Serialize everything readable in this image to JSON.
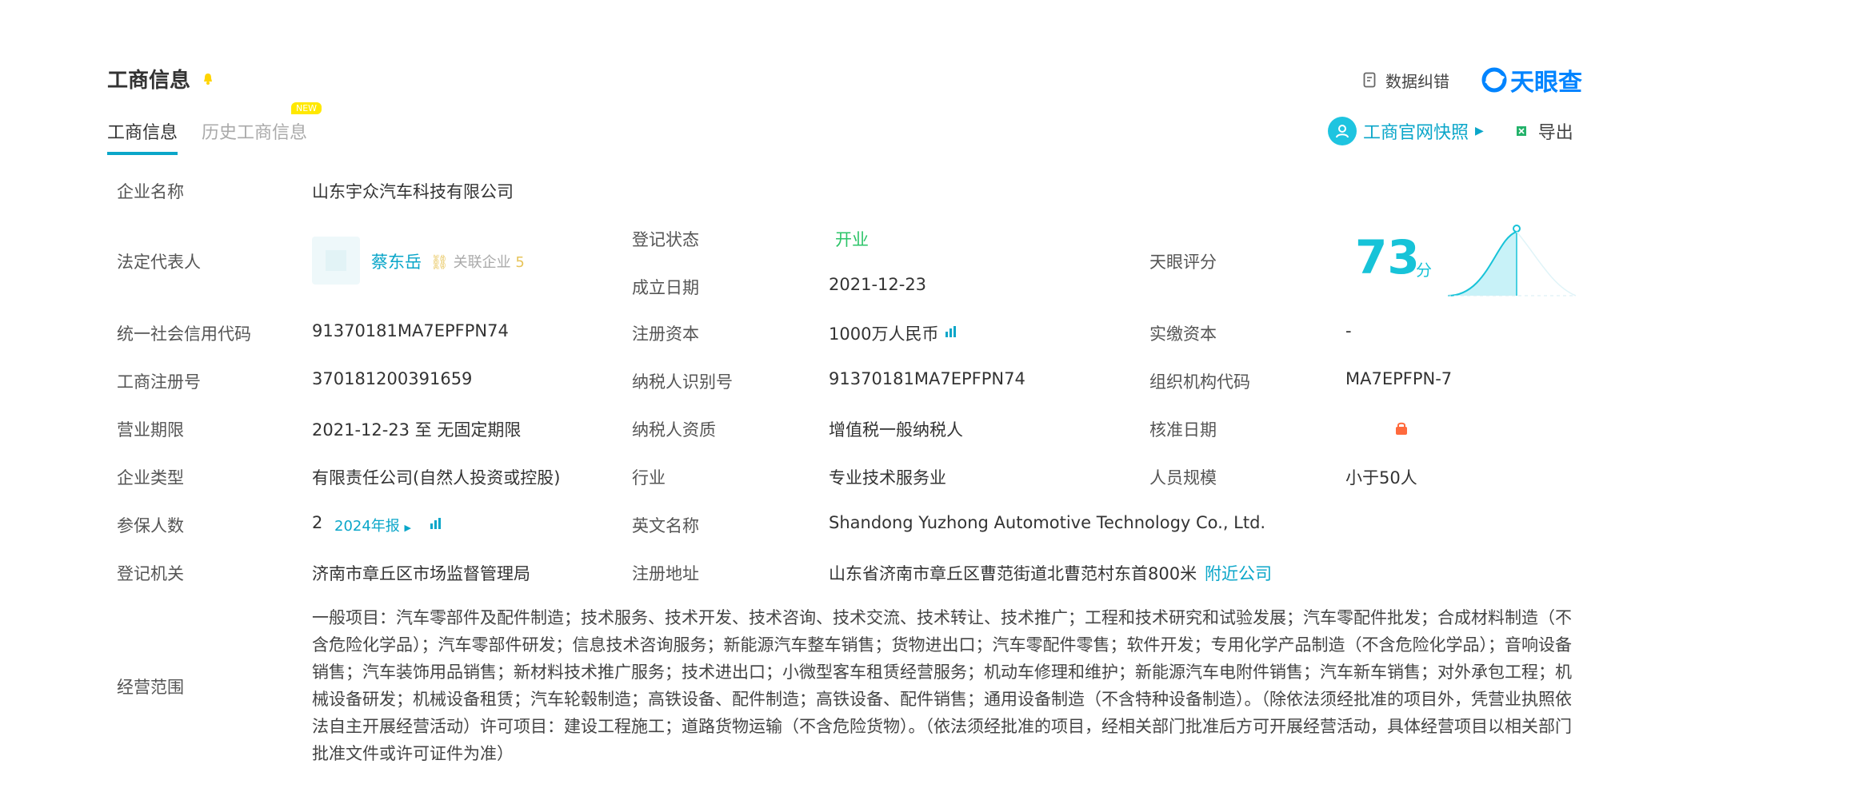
{
  "header": {
    "title": "工商信息",
    "correct_label": "数据纠错",
    "logo_text": "天眼查"
  },
  "tabs": [
    {
      "label": "工商信息",
      "active": true
    },
    {
      "label": "历史工商信息",
      "active": false,
      "badge": "NEW"
    }
  ],
  "actions": {
    "snapshot_label": "工商官网快照",
    "export_label": "导出"
  },
  "info": {
    "company_name": {
      "label": "企业名称",
      "value": "山东宇众汽车科技有限公司"
    },
    "legal_rep": {
      "label": "法定代表人",
      "name": "蔡东岳",
      "related_label": "关联企业",
      "related_count": "5"
    },
    "status": {
      "label": "登记状态",
      "value": "开业"
    },
    "established": {
      "label": "成立日期",
      "value": "2021-12-23"
    },
    "score": {
      "label": "天眼评分",
      "value": "73",
      "unit": "分"
    },
    "credit_code": {
      "label": "统一社会信用代码",
      "value": "91370181MA7EPFPN74"
    },
    "reg_capital": {
      "label": "注册资本",
      "value": "1000万人民币"
    },
    "paid_capital": {
      "label": "实缴资本",
      "value": "-"
    },
    "reg_number": {
      "label": "工商注册号",
      "value": "370181200391659"
    },
    "taxpayer_id": {
      "label": "纳税人识别号",
      "value": "91370181MA7EPFPN74"
    },
    "org_code": {
      "label": "组织机构代码",
      "value": "MA7EPFPN-7"
    },
    "term": {
      "label": "营业期限",
      "value": "2021-12-23 至 无固定期限"
    },
    "taxpayer_qual": {
      "label": "纳税人资质",
      "value": "增值税一般纳税人"
    },
    "approval_date": {
      "label": "核准日期"
    },
    "company_type": {
      "label": "企业类型",
      "value": "有限责任公司(自然人投资或控股)"
    },
    "industry": {
      "label": "行业",
      "value": "专业技术服务业"
    },
    "staff_size": {
      "label": "人员规模",
      "value": "小于50人"
    },
    "insured": {
      "label": "参保人数",
      "value": "2",
      "report_link": "2024年报"
    },
    "english_name": {
      "label": "英文名称",
      "value": "Shandong Yuzhong Automotive Technology Co., Ltd."
    },
    "authority": {
      "label": "登记机关",
      "value": "济南市章丘区市场监督管理局"
    },
    "address": {
      "label": "注册地址",
      "value": "山东省济南市章丘区曹范街道北曹范村东首800米",
      "nearby_link": "附近公司"
    },
    "scope": {
      "label": "经营范围",
      "value": "一般项目：汽车零部件及配件制造；技术服务、技术开发、技术咨询、技术交流、技术转让、技术推广；工程和技术研究和试验发展；汽车零配件批发；合成材料制造（不含危险化学品）；汽车零部件研发；信息技术咨询服务；新能源汽车整车销售；货物进出口；汽车零配件零售；软件开发；专用化学产品制造（不含危险化学品）；音响设备销售；汽车装饰用品销售；新材料技术推广服务；技术进出口；小微型客车租赁经营服务；机动车修理和维护；新能源汽车电附件销售；汽车新车销售；对外承包工程；机械设备研发；机械设备租赁；汽车轮毂制造；高铁设备、配件制造；高铁设备、配件销售；通用设备制造（不含特种设备制造）。（除依法须经批准的项目外，凭营业执照依法自主开展经营活动）许可项目：建设工程施工；道路货物运输（不含危险货物）。（依法须经批准的项目，经相关部门批准后方可开展经营活动，具体经营项目以相关部门批准文件或许可证件为准）"
    }
  },
  "colors": {
    "accent": "#0aa6c9",
    "status_green": "#2cc468",
    "score_cyan": "#17c3d8",
    "lock_orange": "#ff6a3d",
    "badge_yellow": "#ffe800"
  }
}
